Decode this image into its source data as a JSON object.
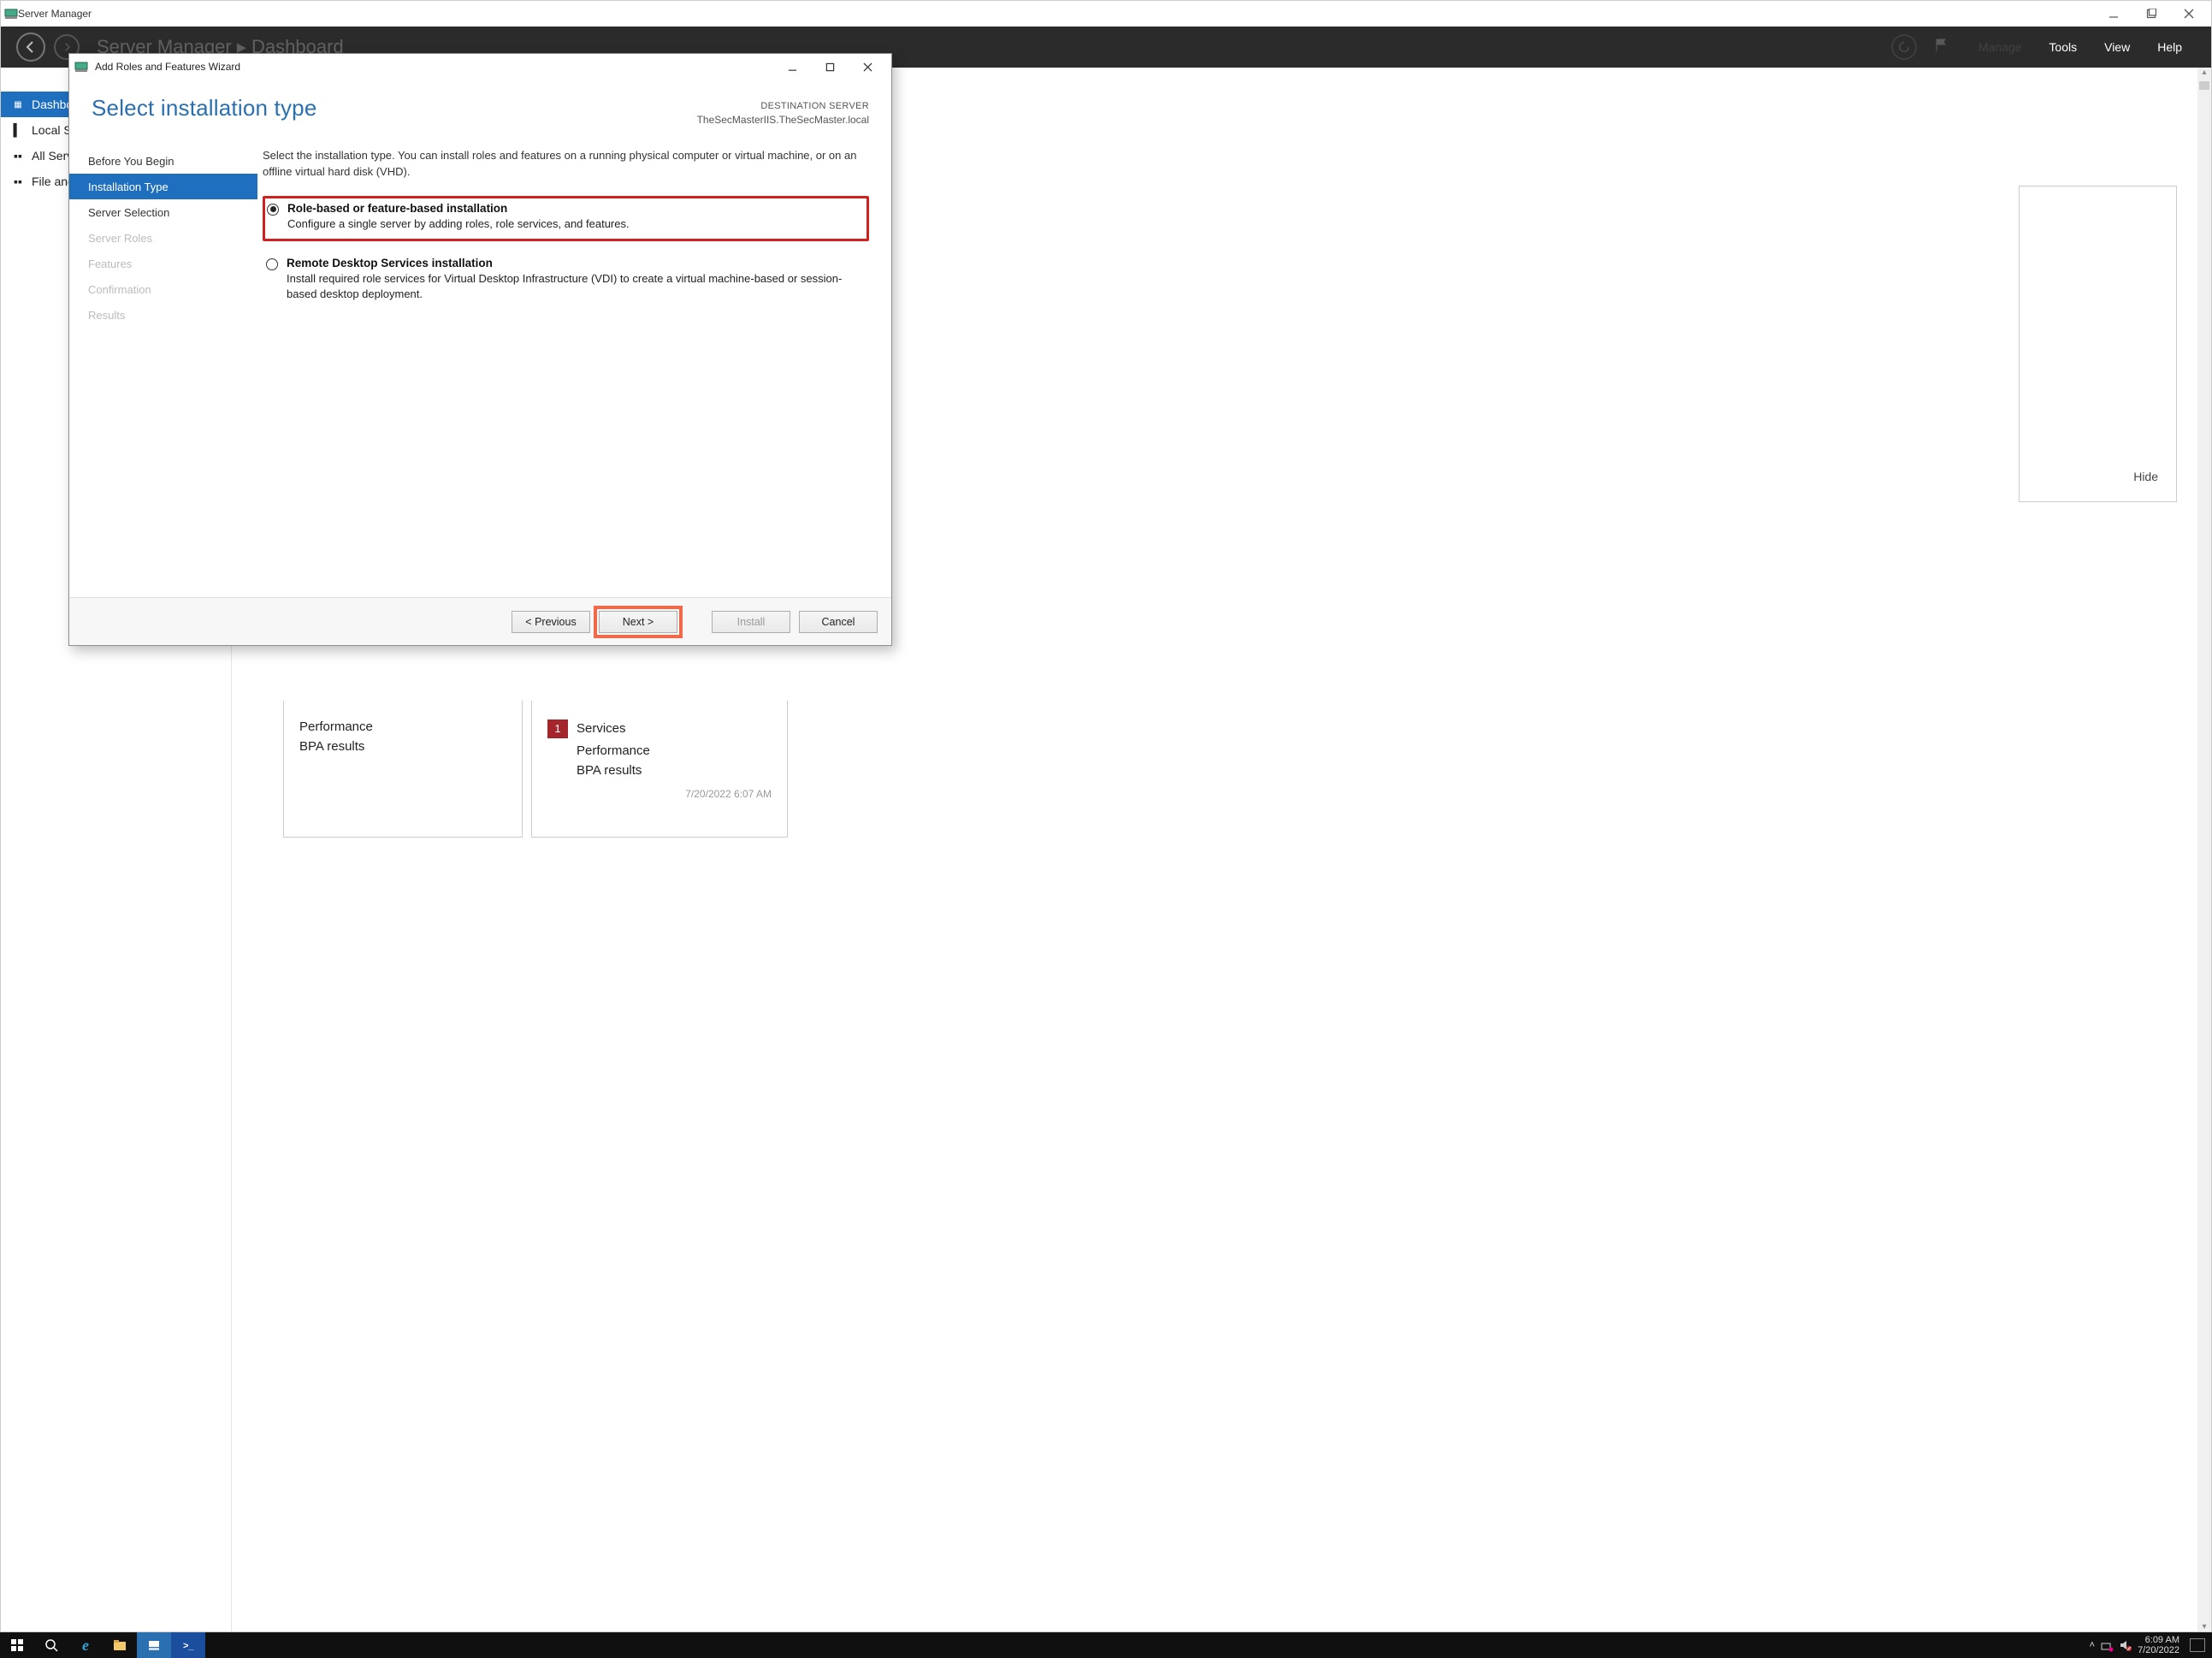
{
  "parent_window": {
    "title": "Server Manager",
    "header_title_fragment": "Server Manager ▸ Dashboard",
    "menus": {
      "tools": "Tools",
      "view": "View",
      "help": "Help"
    },
    "nav": {
      "dashboard": "Dashboard",
      "local": "Local Server",
      "all": "All Servers",
      "file": "File and Storage Services"
    },
    "hide_label": "Hide",
    "tiles": {
      "left": {
        "performance": "Performance",
        "bpa": "BPA results"
      },
      "right": {
        "badge": "1",
        "services": "Services",
        "performance": "Performance",
        "bpa": "BPA results",
        "time": "7/20/2022 6:07 AM"
      }
    }
  },
  "dialog": {
    "title": "Add Roles and Features Wizard",
    "heading": "Select installation type",
    "dest_label": "DESTINATION SERVER",
    "dest_server": "TheSecMasterIIS.TheSecMaster.local",
    "nav": {
      "before": "Before You Begin",
      "type": "Installation Type",
      "server_sel": "Server Selection",
      "server_roles": "Server Roles",
      "features": "Features",
      "confirmation": "Confirmation",
      "results": "Results"
    },
    "intro": "Select the installation type. You can install roles and features on a running physical computer or virtual machine, or on an offline virtual hard disk (VHD).",
    "options": {
      "role": {
        "label": "Role-based or feature-based installation",
        "desc": "Configure a single server by adding roles, role services, and features."
      },
      "rds": {
        "label": "Remote Desktop Services installation",
        "desc": "Install required role services for Virtual Desktop Infrastructure (VDI) to create a virtual machine-based or session-based desktop deployment."
      }
    },
    "buttons": {
      "previous": "< Previous",
      "next": "Next >",
      "install": "Install",
      "cancel": "Cancel"
    }
  },
  "taskbar": {
    "time": "6:09 AM",
    "date": "7/20/2022"
  }
}
